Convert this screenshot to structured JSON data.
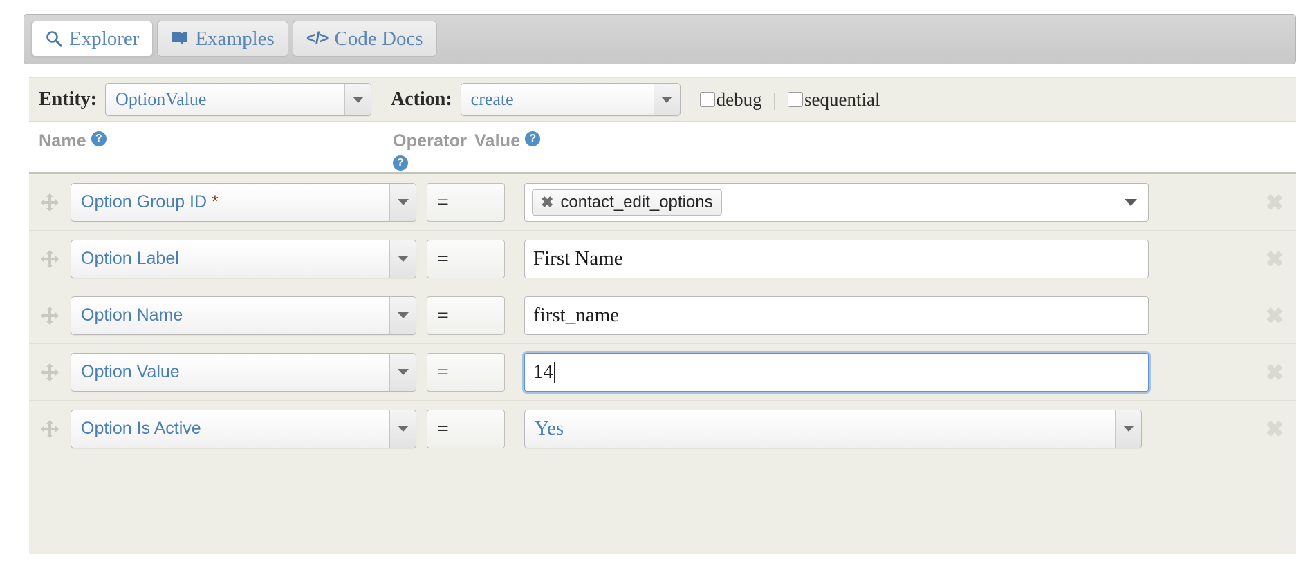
{
  "tabs": [
    {
      "label": "Explorer",
      "icon": "search-icon",
      "active": true
    },
    {
      "label": "Examples",
      "icon": "book-icon",
      "active": false
    },
    {
      "label": "Code Docs",
      "icon": "code-icon",
      "active": false
    }
  ],
  "toolbar": {
    "entity_label": "Entity:",
    "entity_value": "OptionValue",
    "action_label": "Action:",
    "action_value": "create",
    "debug_label": "debug",
    "separator": "|",
    "sequential_label": "sequential",
    "debug_checked": false,
    "sequential_checked": false
  },
  "columns": {
    "name": "Name",
    "operator": "Operator",
    "value": "Value",
    "help_glyph": "?"
  },
  "rows": [
    {
      "name": "Option Group ID",
      "required": true,
      "required_mark": "*",
      "operator": "=",
      "value_type": "token",
      "value": "contact_edit_options",
      "token_remove": "✖",
      "focused": false
    },
    {
      "name": "Option Label",
      "required": false,
      "required_mark": "",
      "operator": "=",
      "value_type": "text",
      "value": "First Name",
      "focused": false
    },
    {
      "name": "Option Name",
      "required": false,
      "required_mark": "",
      "operator": "=",
      "value_type": "text",
      "value": "first_name",
      "focused": false
    },
    {
      "name": "Option Value",
      "required": false,
      "required_mark": "",
      "operator": "=",
      "value_type": "text",
      "value": "14",
      "focused": true
    },
    {
      "name": "Option Is Active",
      "required": false,
      "required_mark": "",
      "operator": "=",
      "value_type": "select",
      "value": "Yes",
      "focused": false
    }
  ],
  "row_delete_glyph": "✖",
  "colors": {
    "link_blue": "#4a7fb5",
    "help_blue": "#4f8fc4",
    "required_red": "#8c2b20",
    "panel_bg": "#eeeee6",
    "focus_ring": "#5b93d6"
  }
}
